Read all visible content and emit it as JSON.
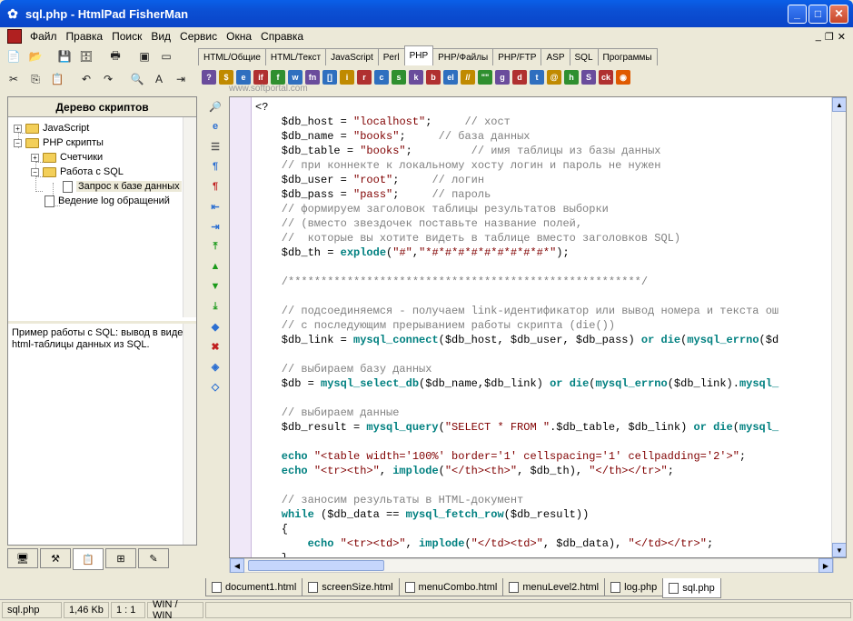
{
  "window": {
    "title": "sql.php - HtmlPad FisherMan"
  },
  "menu": [
    "Файл",
    "Правка",
    "Поиск",
    "Вид",
    "Сервис",
    "Окна",
    "Справка"
  ],
  "toolbar_tabs": [
    "HTML/Общие",
    "HTML/Текст",
    "JavaScript",
    "Perl",
    "PHP",
    "PHP/Файлы",
    "PHP/FTP",
    "ASP",
    "SQL",
    "Программы"
  ],
  "active_toolbar_tab": "PHP",
  "watermark": "www.softportal.com",
  "script_tree": {
    "title": "Дерево скриптов",
    "nodes": [
      "JavaScript",
      "PHP скрипты",
      "Счетчики",
      "Работа с SQL",
      "Запрос к базе данных",
      "Ведение log обращений"
    ],
    "selected": "Запрос к базе данных"
  },
  "description": "Пример работы с SQL: вывод в виде html-таблицы данных из SQL.",
  "code_lines": [
    [
      [
        "o",
        "<?"
      ]
    ],
    [
      [
        "v",
        "    $db_host = "
      ],
      [
        "s",
        "\"localhost\""
      ],
      [
        "o",
        ";     "
      ],
      [
        "c",
        "// хост"
      ]
    ],
    [
      [
        "v",
        "    $db_name = "
      ],
      [
        "s",
        "\"books\""
      ],
      [
        "o",
        ";     "
      ],
      [
        "c",
        "// база данных"
      ]
    ],
    [
      [
        "v",
        "    $db_table = "
      ],
      [
        "s",
        "\"books\""
      ],
      [
        "o",
        ";         "
      ],
      [
        "c",
        "// имя таблицы из базы данных"
      ]
    ],
    [
      [
        "c",
        "    // при коннекте к локальному хосту логин и пароль не нужен"
      ]
    ],
    [
      [
        "v",
        "    $db_user = "
      ],
      [
        "s",
        "\"root\""
      ],
      [
        "o",
        ";     "
      ],
      [
        "c",
        "// логин"
      ]
    ],
    [
      [
        "v",
        "    $db_pass = "
      ],
      [
        "s",
        "\"pass\""
      ],
      [
        "o",
        ";     "
      ],
      [
        "c",
        "// пароль"
      ]
    ],
    [
      [
        "c",
        "    // формируем заголовок таблицы результатов выборки"
      ]
    ],
    [
      [
        "c",
        "    // (вместо звездочек поставьте название полей,"
      ]
    ],
    [
      [
        "c",
        "    //  которые вы хотите видеть в таблице вместо заголовков SQL)"
      ]
    ],
    [
      [
        "v",
        "    $db_th = "
      ],
      [
        "k",
        "explode"
      ],
      [
        "o",
        "("
      ],
      [
        "s",
        "\"#\""
      ],
      [
        "o",
        ","
      ],
      [
        "s",
        "\"*#*#*#*#*#*#*#*#*#*\""
      ],
      [
        "o",
        ");"
      ]
    ],
    [
      [
        "o",
        ""
      ]
    ],
    [
      [
        "c",
        "    /******************************************************/"
      ]
    ],
    [
      [
        "o",
        ""
      ]
    ],
    [
      [
        "c",
        "    // подсоединяемся - получаем link-идентификатор или вывод номера и текста ош"
      ]
    ],
    [
      [
        "c",
        "    // с последующим прерыванием работы скрипта (die())"
      ]
    ],
    [
      [
        "v",
        "    $db_link = "
      ],
      [
        "k",
        "mysql_connect"
      ],
      [
        "o",
        "($db_host, $db_user, $db_pass) "
      ],
      [
        "k",
        "or"
      ],
      [
        "o",
        " "
      ],
      [
        "k",
        "die"
      ],
      [
        "o",
        "("
      ],
      [
        "k",
        "mysql_errno"
      ],
      [
        "o",
        "($d"
      ]
    ],
    [
      [
        "o",
        ""
      ]
    ],
    [
      [
        "c",
        "    // выбираем базу данных"
      ]
    ],
    [
      [
        "v",
        "    $db = "
      ],
      [
        "k",
        "mysql_select_db"
      ],
      [
        "o",
        "($db_name,$db_link) "
      ],
      [
        "k",
        "or"
      ],
      [
        "o",
        " "
      ],
      [
        "k",
        "die"
      ],
      [
        "o",
        "("
      ],
      [
        "k",
        "mysql_errno"
      ],
      [
        "o",
        "($db_link)."
      ],
      [
        "k",
        "mysql_"
      ]
    ],
    [
      [
        "o",
        ""
      ]
    ],
    [
      [
        "c",
        "    // выбираем данные"
      ]
    ],
    [
      [
        "v",
        "    $db_result = "
      ],
      [
        "k",
        "mysql_query"
      ],
      [
        "o",
        "("
      ],
      [
        "s",
        "\"SELECT * FROM \""
      ],
      [
        "o",
        ".$db_table, $db_link) "
      ],
      [
        "k",
        "or"
      ],
      [
        "o",
        " "
      ],
      [
        "k",
        "die"
      ],
      [
        "o",
        "("
      ],
      [
        "k",
        "mysql_"
      ]
    ],
    [
      [
        "o",
        ""
      ]
    ],
    [
      [
        "k",
        "    echo"
      ],
      [
        "o",
        " "
      ],
      [
        "s",
        "\"<table width='100%' border='1' cellspacing='1' cellpadding='2'>\""
      ],
      [
        "o",
        ";"
      ]
    ],
    [
      [
        "k",
        "    echo"
      ],
      [
        "o",
        " "
      ],
      [
        "s",
        "\"<tr><th>\""
      ],
      [
        "o",
        ", "
      ],
      [
        "k",
        "implode"
      ],
      [
        "o",
        "("
      ],
      [
        "s",
        "\"</th><th>\""
      ],
      [
        "o",
        ", $db_th), "
      ],
      [
        "s",
        "\"</th></tr>\""
      ],
      [
        "o",
        ";"
      ]
    ],
    [
      [
        "o",
        ""
      ]
    ],
    [
      [
        "c",
        "    // заносим результаты в HTML-документ"
      ]
    ],
    [
      [
        "k",
        "    while"
      ],
      [
        "o",
        " ($db_data == "
      ],
      [
        "k",
        "mysql_fetch_row"
      ],
      [
        "o",
        "($db_result))"
      ]
    ],
    [
      [
        "o",
        "    {"
      ]
    ],
    [
      [
        "k",
        "        echo"
      ],
      [
        "o",
        " "
      ],
      [
        "s",
        "\"<tr><td>\""
      ],
      [
        "o",
        ", "
      ],
      [
        "k",
        "implode"
      ],
      [
        "o",
        "("
      ],
      [
        "s",
        "\"</td><td>\""
      ],
      [
        "o",
        ", $db_data), "
      ],
      [
        "s",
        "\"</td></tr>\""
      ],
      [
        "o",
        ";"
      ]
    ],
    [
      [
        "o",
        "    }"
      ]
    ]
  ],
  "doc_tabs": [
    "document1.html",
    "screenSize.html",
    "menuCombo.html",
    "menuLevel2.html",
    "log.php",
    "sql.php"
  ],
  "active_doc_tab": "sql.php",
  "status": {
    "file": "sql.php",
    "size": "1,46 Kb",
    "pos": "1 : 1",
    "encoding": "WIN / WIN"
  }
}
